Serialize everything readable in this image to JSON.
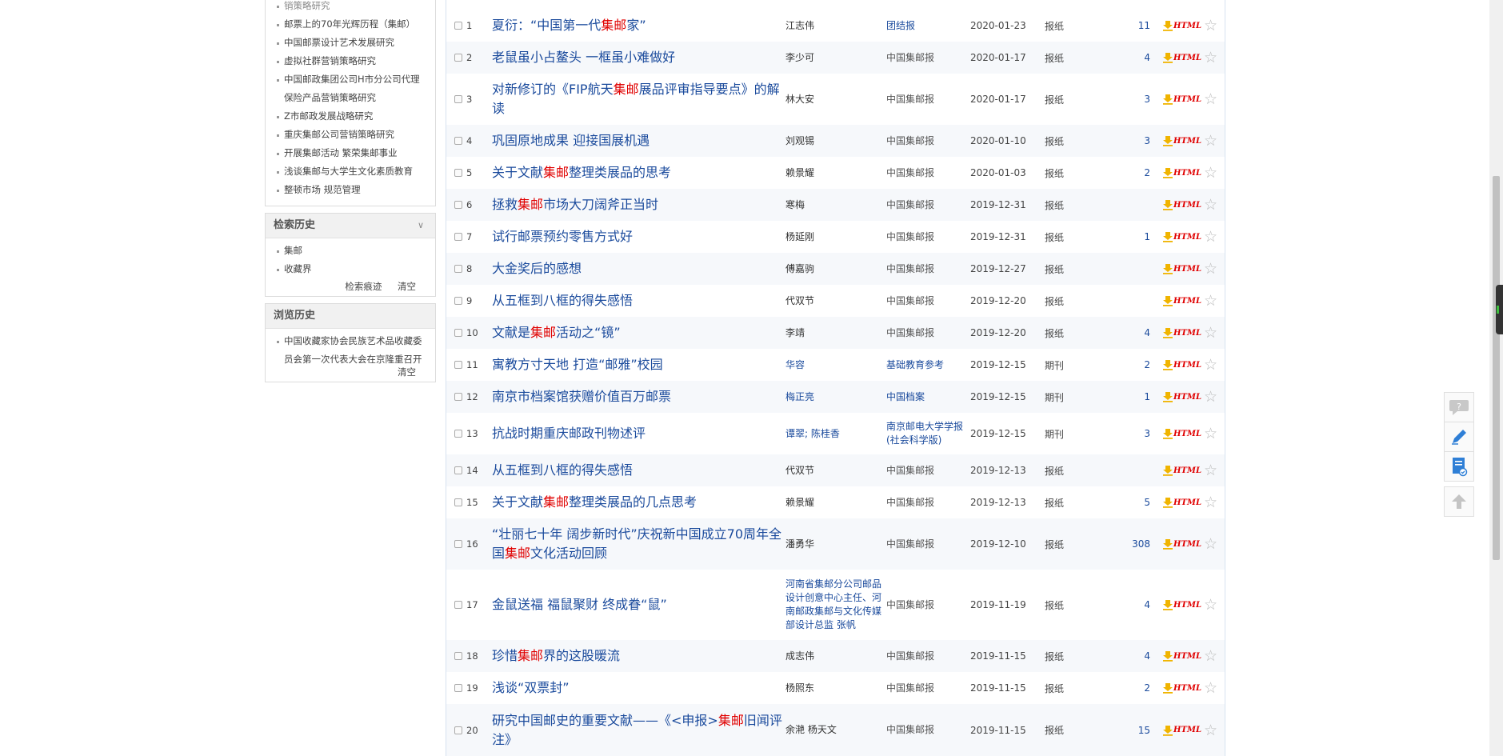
{
  "sidebar": {
    "related_cut": "销策略研究",
    "related_items": [
      "邮票上的70年光辉历程（集邮）",
      "中国邮票设计艺术发展研究",
      "虚拟社群营销策略研究",
      "中国邮政集团公司H市分公司代理保险产品营销策略研究",
      "Z市邮政发展战略研究",
      "重庆集邮公司营销策略研究",
      "开展集邮活动 繁荣集邮事业",
      "浅谈集邮与大学生文化素质教育",
      "整顿市场 规范管理"
    ],
    "search_history": {
      "title": "检索历史",
      "items": [
        "集邮",
        "收藏界"
      ],
      "trace_label": "检索痕迹",
      "clear_label": "清空"
    },
    "browse_history": {
      "title": "浏览历史",
      "items": [
        "中国收藏家协会民族艺术品收藏委员会第一次代表大会在京隆重召开"
      ],
      "clear_label": "清空"
    }
  },
  "results": {
    "html_label": "HTML",
    "rows": [
      {
        "num": "1",
        "title_pre": "夏衍：“中国第一代",
        "title_hl": "集邮",
        "title_post": "家”",
        "author": "江志伟",
        "source": "团结报",
        "source_blue": true,
        "date": "2020-01-23",
        "type": "报纸",
        "downloads": "11"
      },
      {
        "num": "2",
        "title_pre": "老鼠虽小占鳌头 一框虽小难做好",
        "title_hl": "",
        "title_post": "",
        "author": "李少可",
        "source": "中国集邮报",
        "date": "2020-01-17",
        "type": "报纸",
        "downloads": "4"
      },
      {
        "num": "3",
        "title_pre": "对新修订的《FIP航天",
        "title_hl": "集邮",
        "title_post": "展品评审指导要点》的解读",
        "author": "林大安",
        "source": "中国集邮报",
        "date": "2020-01-17",
        "type": "报纸",
        "downloads": "3"
      },
      {
        "num": "4",
        "title_pre": "巩固原地成果 迎接国展机遇",
        "title_hl": "",
        "title_post": "",
        "author": "刘观锡",
        "source": "中国集邮报",
        "date": "2020-01-10",
        "type": "报纸",
        "downloads": "3"
      },
      {
        "num": "5",
        "title_pre": "关于文献",
        "title_hl": "集邮",
        "title_post": "整理类展品的思考",
        "author": "赖景耀",
        "source": "中国集邮报",
        "date": "2020-01-03",
        "type": "报纸",
        "downloads": "2"
      },
      {
        "num": "6",
        "title_pre": "拯救",
        "title_hl": "集邮",
        "title_post": "市场大刀阔斧正当时",
        "author": "寒梅",
        "source": "中国集邮报",
        "date": "2019-12-31",
        "type": "报纸",
        "downloads": ""
      },
      {
        "num": "7",
        "title_pre": "试行邮票预约零售方式好",
        "title_hl": "",
        "title_post": "",
        "author": "杨延刚",
        "source": "中国集邮报",
        "date": "2019-12-31",
        "type": "报纸",
        "downloads": "1"
      },
      {
        "num": "8",
        "title_pre": "大金奖后的感想",
        "title_hl": "",
        "title_post": "",
        "author": "傅嘉驹",
        "source": "中国集邮报",
        "date": "2019-12-27",
        "type": "报纸",
        "downloads": ""
      },
      {
        "num": "9",
        "title_pre": "从五框到八框的得失感悟",
        "title_hl": "",
        "title_post": "",
        "author": "代双节",
        "source": "中国集邮报",
        "date": "2019-12-20",
        "type": "报纸",
        "downloads": ""
      },
      {
        "num": "10",
        "title_pre": "文献是",
        "title_hl": "集邮",
        "title_post": "活动之“镜”",
        "author": "李靖",
        "source": "中国集邮报",
        "date": "2019-12-20",
        "type": "报纸",
        "downloads": "4"
      },
      {
        "num": "11",
        "title_pre": "寓教方寸天地 打造“邮雅”校园",
        "title_hl": "",
        "title_post": "",
        "author": "华容",
        "author_blue": true,
        "source": "基础教育参考",
        "source_blue": true,
        "date": "2019-12-15",
        "type": "期刊",
        "downloads": "2"
      },
      {
        "num": "12",
        "title_pre": "南京市档案馆获赠价值百万邮票",
        "title_hl": "",
        "title_post": "",
        "author": "梅正亮",
        "author_blue": true,
        "source": "中国档案",
        "source_blue": true,
        "date": "2019-12-15",
        "type": "期刊",
        "downloads": "1"
      },
      {
        "num": "13",
        "title_pre": "抗战时期重庆邮政刊物述评",
        "title_hl": "",
        "title_post": "",
        "author": "谭翠; 陈桂香",
        "author_blue": true,
        "source": "南京邮电大学学报(社会科学版)",
        "source_blue": true,
        "date": "2019-12-15",
        "type": "期刊",
        "downloads": "3"
      },
      {
        "num": "14",
        "title_pre": "从五框到八框的得失感悟",
        "title_hl": "",
        "title_post": "",
        "author": "代双节",
        "source": "中国集邮报",
        "date": "2019-12-13",
        "type": "报纸",
        "downloads": ""
      },
      {
        "num": "15",
        "title_pre": "关于文献",
        "title_hl": "集邮",
        "title_post": "整理类展品的几点思考",
        "author": "赖景耀",
        "source": "中国集邮报",
        "date": "2019-12-13",
        "type": "报纸",
        "downloads": "5"
      },
      {
        "num": "16",
        "title_pre": "“壮丽七十年 阔步新时代”庆祝新中国成立70周年全国",
        "title_hl": "集邮",
        "title_post": "文化活动回顾",
        "author": "潘勇华",
        "source": "中国集邮报",
        "date": "2019-12-10",
        "type": "报纸",
        "downloads": "308"
      },
      {
        "num": "17",
        "title_pre": "金鼠送福 福鼠聚财 终成眷“鼠”",
        "title_hl": "",
        "title_post": "",
        "author": "河南省集邮分公司邮品设计创意中心主任、河南邮政集邮与文化传媒部设计总监 张帆",
        "author_blue": true,
        "source": "中国集邮报",
        "date": "2019-11-19",
        "type": "报纸",
        "downloads": "4"
      },
      {
        "num": "18",
        "title_pre": "珍惜",
        "title_hl": "集邮",
        "title_post": "界的这股暖流",
        "author": "成志伟",
        "source": "中国集邮报",
        "date": "2019-11-15",
        "type": "报纸",
        "downloads": "4"
      },
      {
        "num": "19",
        "title_pre": "浅谈“双票封”",
        "title_hl": "",
        "title_post": "",
        "author": "杨照东",
        "source": "中国集邮报",
        "date": "2019-11-15",
        "type": "报纸",
        "downloads": "2"
      },
      {
        "num": "20",
        "title_pre": "研究中国邮史的重要文献——《<申报>",
        "title_hl": "集邮",
        "title_post": "旧闻评注》",
        "author": "余滟 杨天文",
        "source": "中国集邮报",
        "date": "2019-11-15",
        "type": "报纸",
        "downloads": "15"
      }
    ]
  },
  "icons": {
    "download": "download-icon",
    "html": "html-icon",
    "star": "star-icon",
    "help": "question-icon",
    "edit": "pencil-icon",
    "note": "notebook-icon",
    "top": "arrow-up-icon"
  },
  "colors": {
    "link": "#1a4a9c",
    "highlight": "#e00000",
    "download": "#f0b400"
  }
}
